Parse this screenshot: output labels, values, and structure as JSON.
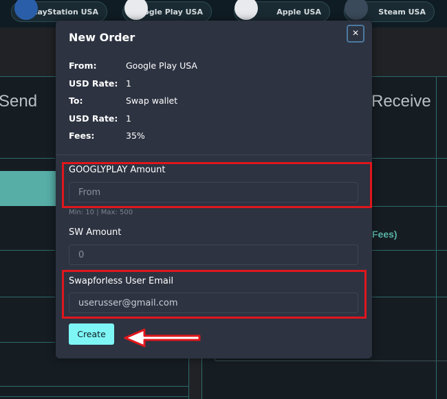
{
  "topbar": {
    "cards": [
      {
        "label": "PlayStation USA",
        "icon": "playstation-icon",
        "color": "#2a5ea8"
      },
      {
        "label": "Google Play USA",
        "icon": "google-play-icon",
        "color": "#e8eaed"
      },
      {
        "label": "Apple USA",
        "icon": "apple-icon",
        "color": "#e8eaed"
      },
      {
        "label": "Steam USA",
        "icon": "steam-icon",
        "color": "#3b4a5a"
      }
    ]
  },
  "background": {
    "send_heading": "Send",
    "receive_heading": "Receive",
    "fees_text": "Fees)"
  },
  "modal": {
    "title": "New Order",
    "close_label": "×",
    "info": [
      {
        "label": "From:",
        "value": "Google Play USA"
      },
      {
        "label": "USD Rate:",
        "value": "1"
      },
      {
        "label": "To:",
        "value": "Swap wallet"
      },
      {
        "label": "USD Rate:",
        "value": "1"
      },
      {
        "label": "Fees:",
        "value": "35%"
      }
    ],
    "amount": {
      "label": "GOOGLYPLAY Amount",
      "placeholder": "From",
      "hint": "Min: 10 | Max: 500"
    },
    "sw_amount": {
      "label": "SW Amount",
      "placeholder": "0"
    },
    "email": {
      "label": "Swapforless User Email",
      "value": "userusser@gmail.com"
    },
    "create_label": "Create"
  },
  "colors": {
    "accent": "#7ef6f6",
    "highlight": "#e0161c",
    "modal_bg": "#2d3341"
  }
}
